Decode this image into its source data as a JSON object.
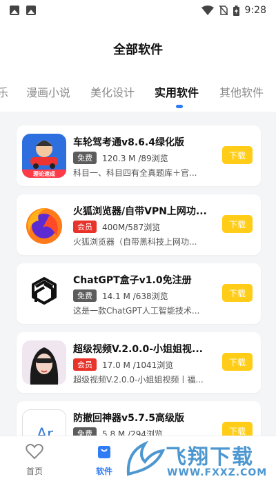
{
  "status_bar": {
    "time": "9:28"
  },
  "header": {
    "title": "全部软件"
  },
  "tabs": [
    {
      "label": "乐",
      "active": false
    },
    {
      "label": "漫画小说",
      "active": false
    },
    {
      "label": "美化设计",
      "active": false
    },
    {
      "label": "实用软件",
      "active": true
    },
    {
      "label": "其他软件",
      "active": false
    }
  ],
  "apps": [
    {
      "name": "车轮驾考通v8.6.4绿化版",
      "badge": "免费",
      "badge_type": "free",
      "meta": "120.3 M /89浏览",
      "desc": "科目一、科目四有全真题库＋官...",
      "download": "下载",
      "icon": "car-driving-icon",
      "icon_caption": "理论速成"
    },
    {
      "name": "火狐浏览器/自带VPN上网功...",
      "badge": "会员",
      "badge_type": "vip",
      "meta": "400M/587浏览",
      "desc": "火狐浏览器（自带黑科技上网功...",
      "download": "下载",
      "icon": "firefox-icon"
    },
    {
      "name": "ChatGPT盒子v1.0免注册",
      "badge": "免费",
      "badge_type": "free",
      "meta": "14.1 M /638浏览",
      "desc": "这是一款ChatGPT人工智能技术...",
      "download": "下载",
      "icon": "chatgpt-icon"
    },
    {
      "name": "超级视频V.2.0.0-小姐姐视...",
      "badge": "会员",
      "badge_type": "vip",
      "meta": "17.0 M /1041浏览",
      "desc": "超级视频V.2.0.0-小姐姐视频丨福...",
      "download": "下载",
      "icon": "video-girl-icon"
    },
    {
      "name": "防撤回神器v5.7.5高级版",
      "badge": "免费",
      "badge_type": "free",
      "meta": "5.8 M /294浏览",
      "desc": "",
      "download": "下载",
      "icon": "anti-recall-icon",
      "icon_caption": "Ar"
    }
  ],
  "bottom_nav": [
    {
      "label": "首页",
      "active": false,
      "icon": "heart-icon"
    },
    {
      "label": "软件",
      "active": true,
      "icon": "bag-icon"
    }
  ],
  "watermark": {
    "main": "飞翔下载",
    "sub": "WWW.FXXZ.COM"
  },
  "colors": {
    "accent": "#2f7cf6",
    "download": "#ffcd17",
    "vip": "#e8332a",
    "free": "#5c5c5c"
  }
}
